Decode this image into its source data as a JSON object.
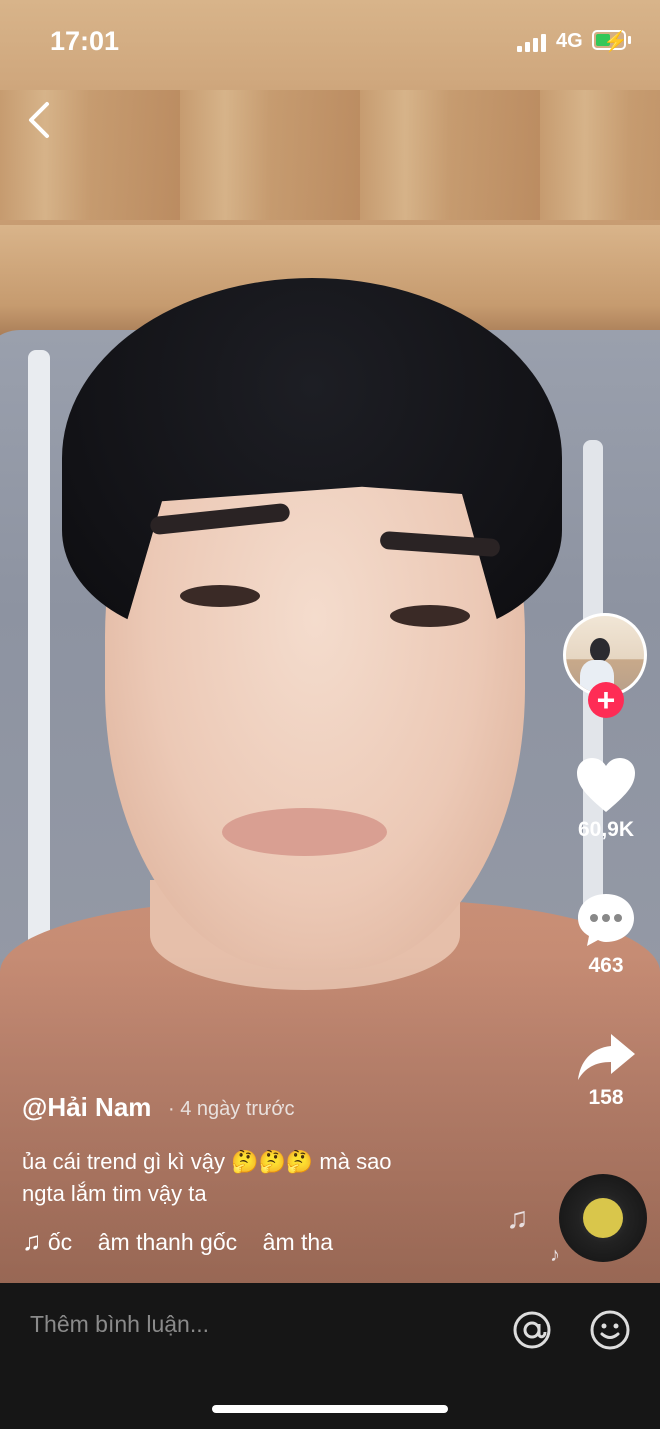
{
  "status_bar": {
    "time": "17:01",
    "network": "4G"
  },
  "video": {
    "description_visible": false
  },
  "side_actions": {
    "likes": "60,9K",
    "comments": "463",
    "shares": "158"
  },
  "post": {
    "username": "@Hải Nam",
    "time_ago": "· 4 ngày trước",
    "caption_line1": "ủa cái trend gì kì vậy 🤔🤔🤔 mà sao",
    "caption_line2": "ngta lắm tim vậy ta",
    "music": "ốc    âm thanh gốc    âm tha"
  },
  "comment_bar": {
    "placeholder": "Thêm bình luận..."
  },
  "colors": {
    "accent": "#fe2c55",
    "battery": "#34c759",
    "comment_bar_bg": "#161616"
  },
  "icons": [
    "back-chevron-icon",
    "heart-icon",
    "comment-icon",
    "share-icon",
    "music-note-icon",
    "at-icon",
    "emoji-icon"
  ]
}
